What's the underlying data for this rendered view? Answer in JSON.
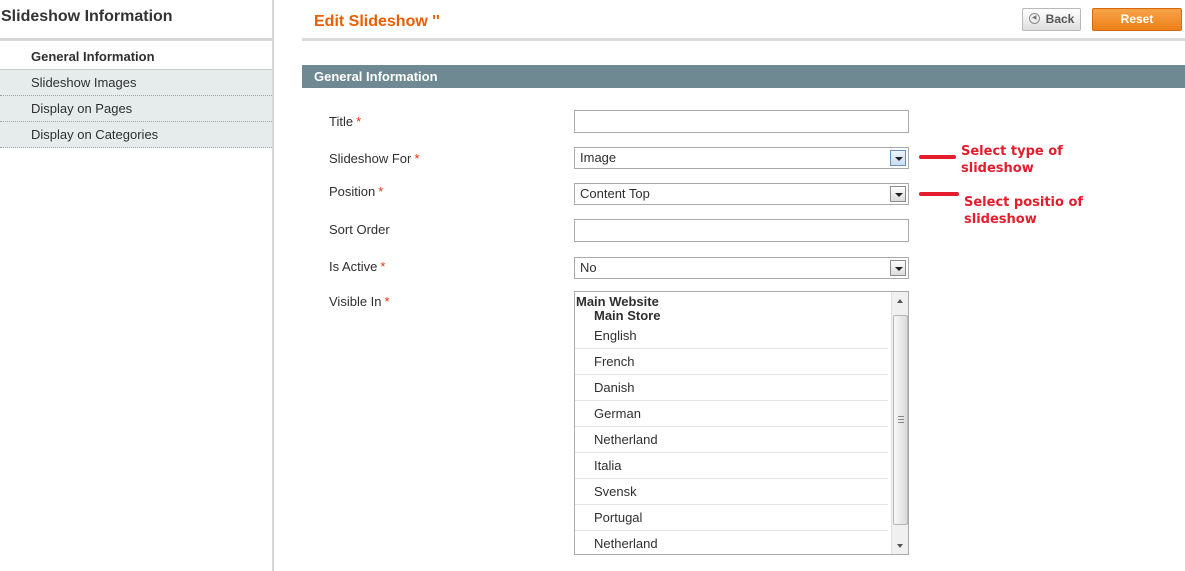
{
  "sidebar": {
    "title": "Slideshow Information",
    "tabs": [
      {
        "label": "General Information",
        "active": true
      },
      {
        "label": "Slideshow Images",
        "active": false
      },
      {
        "label": "Display on Pages",
        "active": false
      },
      {
        "label": "Display on Categories",
        "active": false
      }
    ]
  },
  "header": {
    "title": "Edit Slideshow ''",
    "back_label": "Back",
    "reset_label": "Reset"
  },
  "fieldset": {
    "title": "General Information",
    "required_marker": "*",
    "fields": {
      "title": {
        "label": "Title",
        "value": ""
      },
      "slideshow_for": {
        "label": "Slideshow For",
        "value": "Image"
      },
      "position": {
        "label": "Position",
        "value": "Content Top"
      },
      "sort_order": {
        "label": "Sort Order",
        "value": ""
      },
      "is_active": {
        "label": "Is Active",
        "value": "No"
      },
      "visible_in": {
        "label": "Visible In",
        "group": "Main Website",
        "subgroup": "Main Store",
        "options": [
          "English",
          "French",
          "Danish",
          "German",
          "Netherland",
          "Italia",
          "Svensk",
          "Portugal",
          "Netherland"
        ]
      }
    }
  },
  "annotations": {
    "type_note": "Select type of slideshow",
    "position_note": "Select positio of slideshow",
    "color": "#e41d2d"
  },
  "colors": {
    "accent": "#eb5e00",
    "fieldset_header": "#6f8992",
    "reset_button": "#ed7f17"
  }
}
